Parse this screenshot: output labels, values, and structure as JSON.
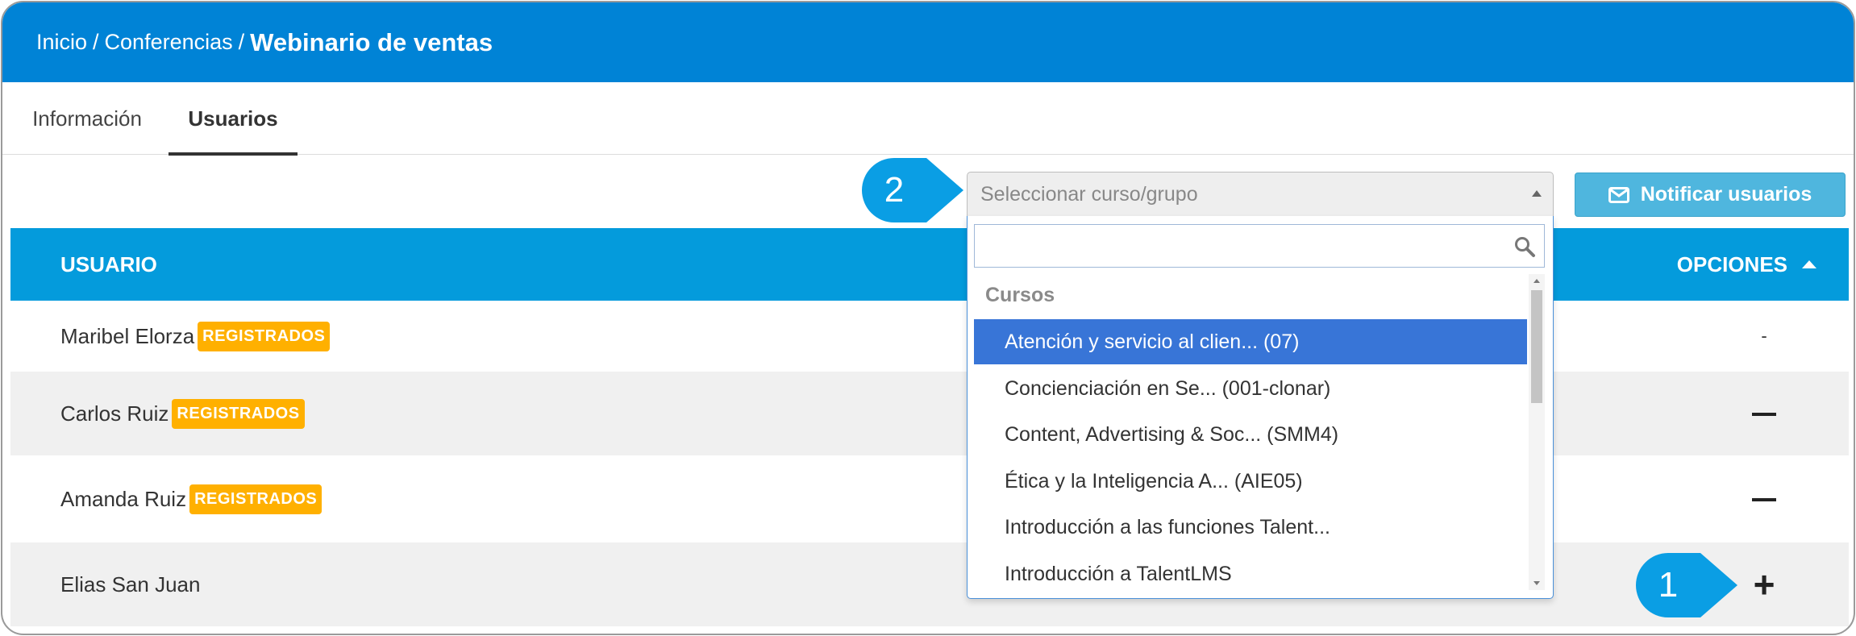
{
  "breadcrumb": {
    "items": [
      "Inicio",
      "Conferencias"
    ],
    "separator": "/",
    "current": "Webinario de ventas"
  },
  "tabs": [
    {
      "label": "Información",
      "active": false
    },
    {
      "label": "Usuarios",
      "active": true
    }
  ],
  "toolbar": {
    "select_placeholder": "Seleccionar curso/grupo",
    "notify_label": "Notificar usuarios"
  },
  "table": {
    "columns": {
      "user": "USUARIO",
      "options": "OPCIONES"
    },
    "rows": [
      {
        "name": "Maribel Elorza",
        "badge": "REGISTRADOS",
        "option": "-"
      },
      {
        "name": "Carlos Ruiz",
        "badge": "REGISTRADOS",
        "option": "remove"
      },
      {
        "name": "Amanda Ruiz",
        "badge": "REGISTRADOS",
        "option": "remove"
      },
      {
        "name": "Elias San Juan",
        "badge": "",
        "option": "add"
      }
    ]
  },
  "dropdown": {
    "search_value": "",
    "group_label": "Cursos",
    "items": [
      {
        "label": "Atención y servicio al clien... (07)",
        "highlighted": true
      },
      {
        "label": "Concienciación en Se... (001-clonar)",
        "highlighted": false
      },
      {
        "label": "Content, Advertising & Soc... (SMM4)",
        "highlighted": false
      },
      {
        "label": "Ética y la Inteligencia A... (AIE05)",
        "highlighted": false
      },
      {
        "label": "Introducción a las funciones Talent...",
        "highlighted": false
      },
      {
        "label": "Introducción a TalentLMS",
        "highlighted": false
      }
    ]
  },
  "callouts": {
    "one": "1",
    "two": "2"
  },
  "colors": {
    "topbar": "#0083d6",
    "table_header": "#049bdc",
    "badge": "#ffb000",
    "notify_button": "#4fb6de",
    "highlight": "#3875d7",
    "callout": "#0a9ee4"
  },
  "icons": {
    "notify": "envelope-icon",
    "search": "magnifier-icon",
    "sort": "caret-up-icon"
  }
}
